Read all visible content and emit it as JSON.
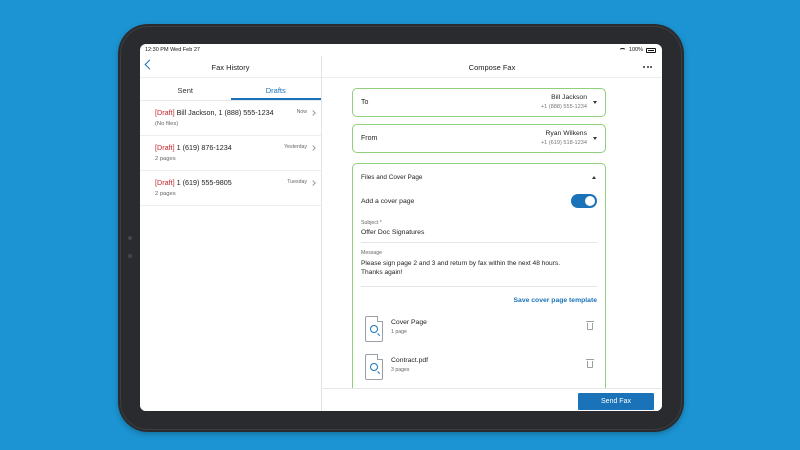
{
  "status_bar": {
    "time": "12:30 PM  Wed Feb 27",
    "battery": "100%"
  },
  "left_pane": {
    "title": "Fax History",
    "tabs": [
      {
        "label": "Sent",
        "active": false
      },
      {
        "label": "Drafts",
        "active": true
      }
    ],
    "drafts": [
      {
        "tag": "[Draft]",
        "recipient": " Bill Jackson, 1 (888) 555-1234",
        "sub": "(No files)",
        "time": "Now"
      },
      {
        "tag": "[Draft]",
        "recipient": " 1 (619) 876-1234",
        "sub": "2 pages",
        "time": "Yesterday"
      },
      {
        "tag": "[Draft]",
        "recipient": " 1 (619) 555-9805",
        "sub": "2 pages",
        "time": "Tuesday"
      }
    ]
  },
  "compose": {
    "title": "Compose Fax",
    "to": {
      "label": "To",
      "name": "Bill Jackson",
      "number": "+1 (888) 555-1234"
    },
    "from": {
      "label": "From",
      "name": "Ryan Wilkens",
      "number": "+1 (619) 518-1234"
    },
    "files_section": {
      "title": "Files and Cover Page",
      "cover_toggle_label": "Add a cover page",
      "cover_toggle_on": true,
      "subject_label": "Subject *",
      "subject_value": "Offer Doc Signatures",
      "message_label": "Message",
      "message_value": "Please sign page 2 and 3 and return by fax within the next 48 hours. Thanks again!",
      "save_template_label": "Save cover page template",
      "files": [
        {
          "name": "Cover Page",
          "pages": "1 page"
        },
        {
          "name": "Contract.pdf",
          "pages": "3 pages"
        }
      ]
    },
    "send_label": "Send Fax"
  },
  "colors": {
    "background": "#1c94d3",
    "accent": "#1a73b8",
    "draft_tag": "#c4232b",
    "field_border": "#8fd07a"
  }
}
